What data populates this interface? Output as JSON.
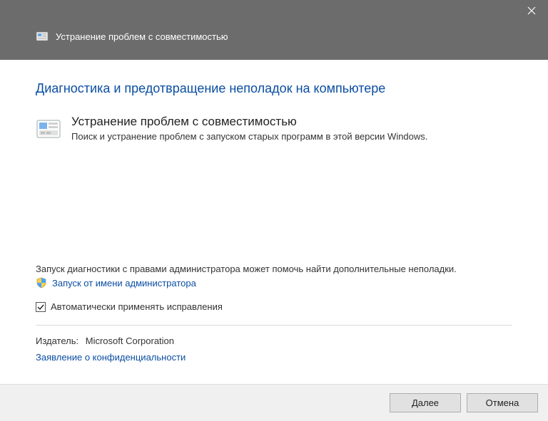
{
  "titlebar": {
    "title": "Устранение проблем с совместимостью"
  },
  "content": {
    "heading": "Диагностика и предотвращение неполадок на компьютере",
    "section": {
      "title": "Устранение проблем с совместимостью",
      "description": "Поиск и устранение проблем с запуском старых программ в этой версии Windows."
    },
    "admin": {
      "text": "Запуск диагностики с правами администратора может помочь найти дополнительные неполадки.",
      "link": "Запуск от имени администратора"
    },
    "checkbox": {
      "label": "Автоматически применять исправления",
      "checked": true
    },
    "publisher": {
      "label": "Издатель:",
      "value": "Microsoft Corporation"
    },
    "privacy": {
      "link": "Заявление о конфиденциальности"
    }
  },
  "buttons": {
    "next": "Далее",
    "cancel": "Отмена"
  }
}
